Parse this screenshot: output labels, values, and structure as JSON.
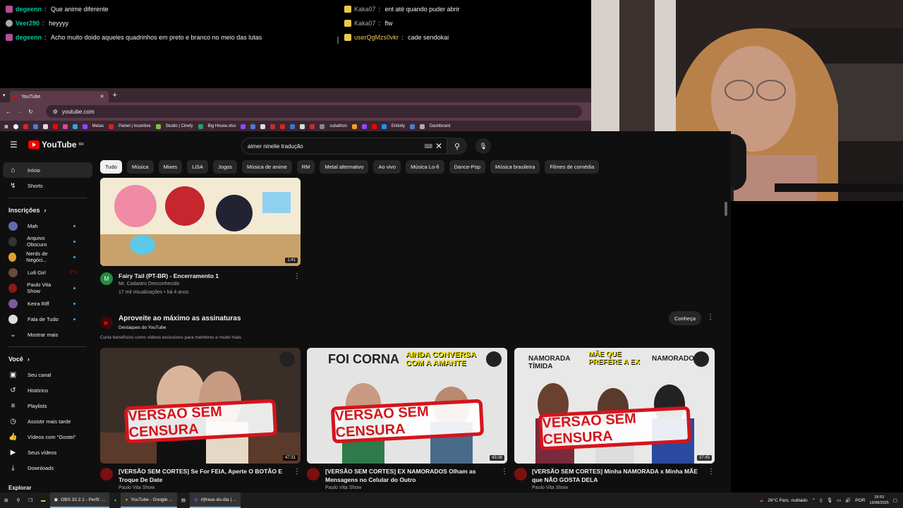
{
  "chat": {
    "left": [
      {
        "user": "degeenn",
        "text": "Que anime diferente",
        "color": "#00c8a0"
      },
      {
        "user": "Veer290",
        "text": "heyyyy",
        "color": "#00c8a0"
      },
      {
        "user": "degeenn",
        "text": "Acho muito doido aqueles quadrinhos em preto e branco no meio das lutas",
        "color": "#00c8a0"
      }
    ],
    "right": [
      {
        "user": "Kaka07",
        "text": "ent até quando puder abrir",
        "color": "#aaaaaa"
      },
      {
        "user": "Kaka07",
        "text": "flw",
        "color": "#aaaaaa"
      },
      {
        "user": "userQgMzs0vkr",
        "text": "cade sendokai",
        "color": "#e8c94e"
      }
    ]
  },
  "browser": {
    "tab_title": "YouTube",
    "url": "youtube.com",
    "bookmarks": [
      "Metas",
      "Painel | Incentive",
      "Studio | Cinefy",
      "Big House.xlsx",
      "subathon",
      "Enlistly",
      "Dashboard"
    ]
  },
  "youtube": {
    "logo": "YouTube",
    "region": "BR",
    "search_query": "aimer ninelie tradução",
    "chips": [
      "Tudo",
      "Música",
      "Mixes",
      "LiSA",
      "Jogos",
      "Música de anime",
      "RM",
      "Metal alternativo",
      "Ao vivo",
      "Música Lo-fi",
      "Dance-Pop",
      "Música brasileira",
      "Filmes de comédia"
    ],
    "sidebar": {
      "home": "Início",
      "shorts": "Shorts",
      "subs_heading": "Inscrições",
      "subs": [
        "Mah",
        "Arquivo Obscuro",
        "Nerds de Negóci...",
        "Lofi Girl",
        "Paulo Vita Show",
        "Keira Riff",
        "Fala de Tudo"
      ],
      "show_more": "Mostrar mais",
      "you_heading": "Você",
      "you_items": [
        "Seu canal",
        "Histórico",
        "Playlists",
        "Assistir mais tarde",
        "Vídeos com \"Gostei\"",
        "Seus vídeos",
        "Downloads"
      ],
      "explore": "Explorar"
    },
    "video1": {
      "title": "Fairy Tail (PT-BR) - Encerramento 1",
      "channel": "Mr. Cadastro Desconhecido",
      "meta": "17 mil visualizações • há 4 anos",
      "duration": "1:41",
      "avatar_letter": "M"
    },
    "promo": {
      "title": "Aproveite ao máximo as assinaturas",
      "subtitle": "Destaques do YouTube",
      "desc": "Curta benefícios como vídeos exclusivos para membros e muito mais",
      "button": "Conheça"
    },
    "videos": [
      {
        "title": "[VERSÃO SEM CORTES] Se For FEIA, Aperte O BOTÃO E Troque De Date",
        "channel": "Paulo Vita Show",
        "duration": "47:31",
        "overlay": "VERSÃO SEM CENSURA",
        "ribbon": []
      },
      {
        "title": "[VERSÃO SEM CORTES] EX NAMORADOS Olham as Mensagens no Celular do Outro",
        "channel": "Paulo Vita Show",
        "duration": "43:36",
        "overlay": "VERSÃO SEM CENSURA",
        "ribbon": [
          "FOI CORNA",
          "AINDA CONVERSA COM A AMANTE"
        ]
      },
      {
        "title": "[VERSÃO SEM CORTES] Minha NAMORADA x Minha MÃE que NÃO GOSTA DELA",
        "channel": "Paulo Vita Show",
        "duration": "37:45",
        "overlay": "VERSÃO SEM CENSURA",
        "ribbon": [
          "NAMORADA TÍMIDA",
          "MÃE QUE PREFERE A EX",
          "NAMORADO"
        ]
      }
    ]
  },
  "taskbar": {
    "apps": [
      "OBS 32.2.1 - Perfil: ...",
      "YouTube - Google ...",
      "#|frase-do-dia | ..."
    ],
    "weather": "26°C  Parc. nublado",
    "lang": "POR",
    "time": "18:53",
    "date": "13/08/2025"
  }
}
